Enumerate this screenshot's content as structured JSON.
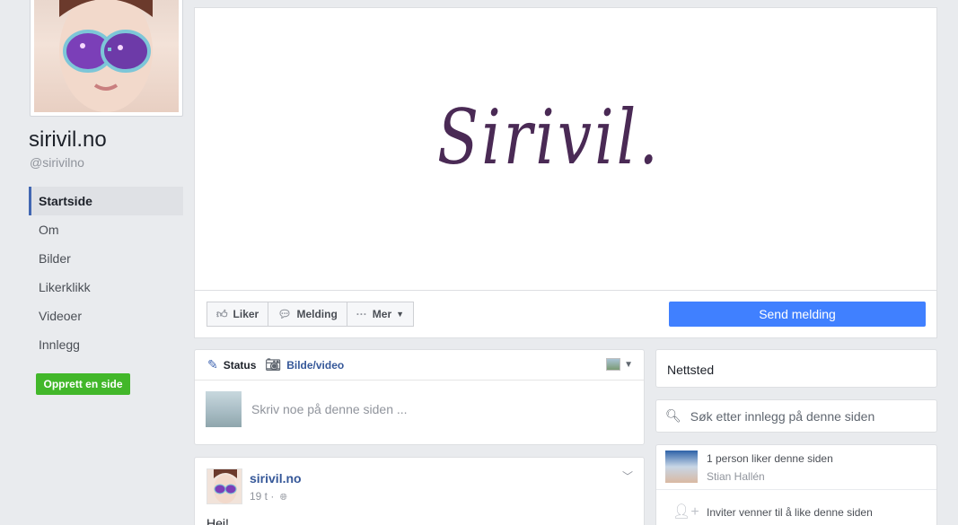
{
  "page": {
    "name": "sirivil.no",
    "handle": "@sirivilno"
  },
  "nav": {
    "items": [
      {
        "label": "Startside",
        "active": true
      },
      {
        "label": "Om"
      },
      {
        "label": "Bilder"
      },
      {
        "label": "Likerklikk"
      },
      {
        "label": "Videoer"
      },
      {
        "label": "Innlegg"
      }
    ],
    "create_page_label": "Opprett en side"
  },
  "cover": {
    "logo_text": "Sirivil."
  },
  "actions": {
    "like_label": "Liker",
    "message_label": "Melding",
    "more_label": "Mer",
    "send_message_label": "Send melding"
  },
  "composer": {
    "tab_status": "Status",
    "tab_photo": "Bilde/video",
    "placeholder": "Skriv noe på denne siden ..."
  },
  "post": {
    "author": "sirivil.no",
    "time": "19 t ·",
    "text": "Hei!"
  },
  "sidebar": {
    "website_label": "Nettsted",
    "search_placeholder": "Søk etter innlegg på denne siden",
    "likes_text": "1 person liker denne siden",
    "liker_name": "Stian Hallén",
    "invite_text": "Inviter venner til å like denne siden"
  },
  "colors": {
    "accent": "#4267b2",
    "send_button": "#4080ff",
    "create_button": "#42b72a",
    "link": "#365899",
    "logo": "#4a2a55"
  }
}
